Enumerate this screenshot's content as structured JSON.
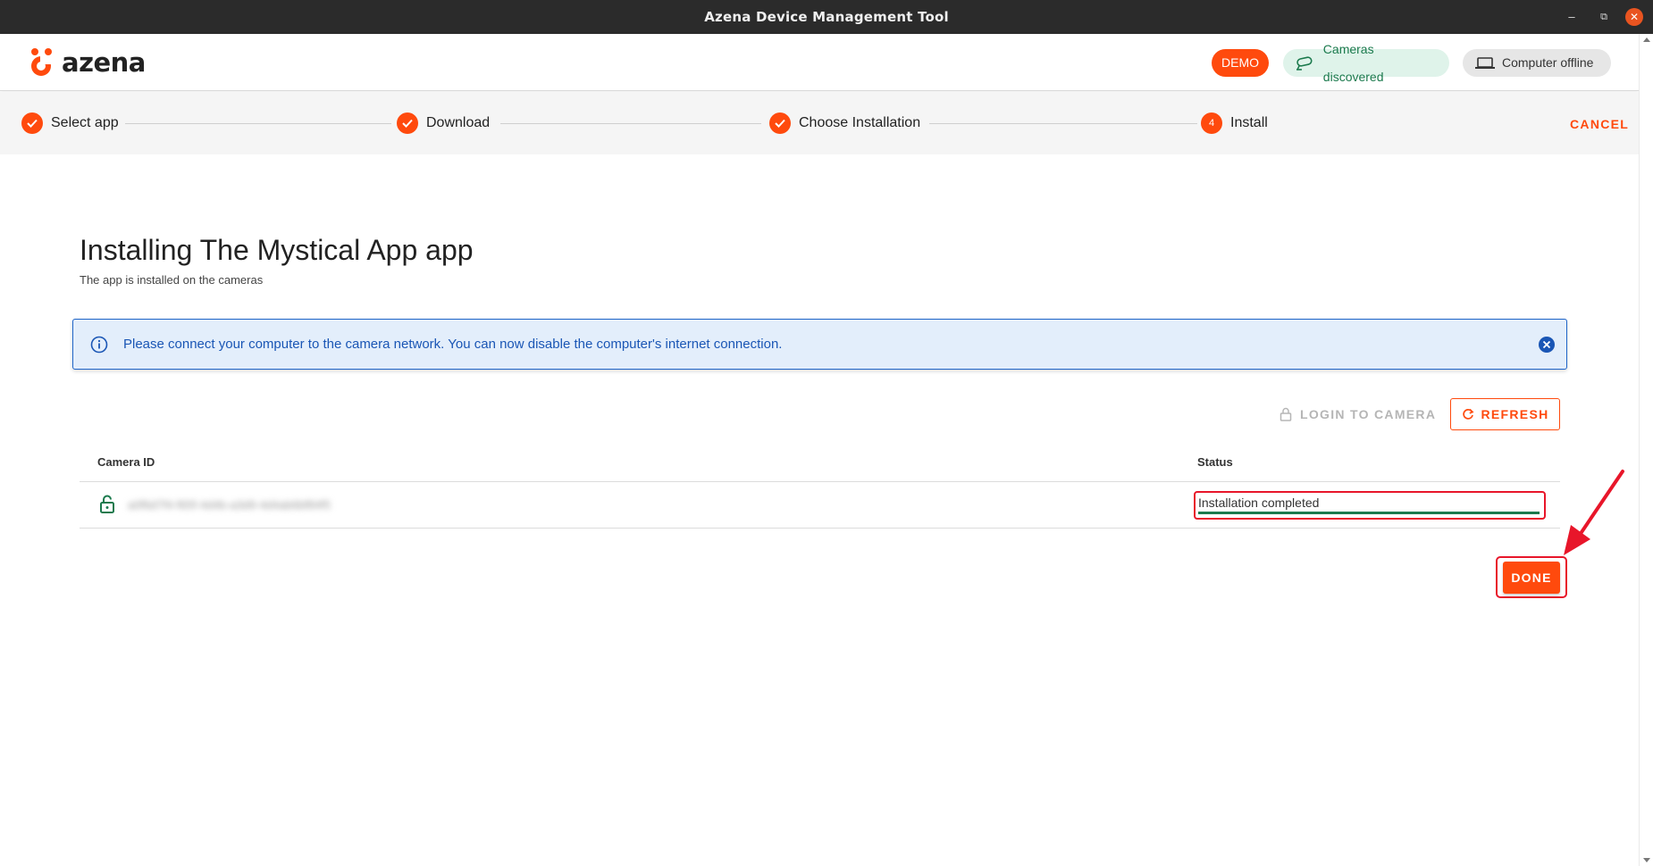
{
  "window": {
    "title": "Azena Device Management Tool",
    "controls": [
      "minimize-icon",
      "maximize-icon",
      "close-icon"
    ]
  },
  "header": {
    "logo_text": "azena",
    "demo_badge": "DEMO",
    "cameras_status": "Cameras discovered",
    "computer_status": "Computer offline",
    "colors": {
      "accent": "#ff4a0d",
      "success": "#1b7a4d",
      "success_bg": "#dff3ea"
    }
  },
  "stepper": {
    "steps": [
      {
        "label": "Select app",
        "state": "done"
      },
      {
        "label": "Download",
        "state": "done"
      },
      {
        "label": "Choose Installation",
        "state": "done"
      },
      {
        "label": "Install",
        "state": "active",
        "number": "4"
      }
    ],
    "cancel_label": "CANCEL"
  },
  "main": {
    "title": "Installing The Mystical App app",
    "subtitle": "The app is installed on the cameras",
    "alert": {
      "text": "Please connect your computer to the camera network. You can now disable the computer's internet connection.",
      "icon": "info-icon"
    },
    "actions": {
      "login_label": "LOGIN TO CAMERA",
      "refresh_label": "REFRESH"
    },
    "table": {
      "columns": [
        "Camera ID",
        "Status"
      ],
      "rows": [
        {
          "camera_id": "a0f6d7f4-f65f-4d4b-a3d9-4d4ab6bf84f5",
          "status": "Installation completed",
          "progress": 1.0
        }
      ]
    },
    "done_label": "DONE"
  }
}
